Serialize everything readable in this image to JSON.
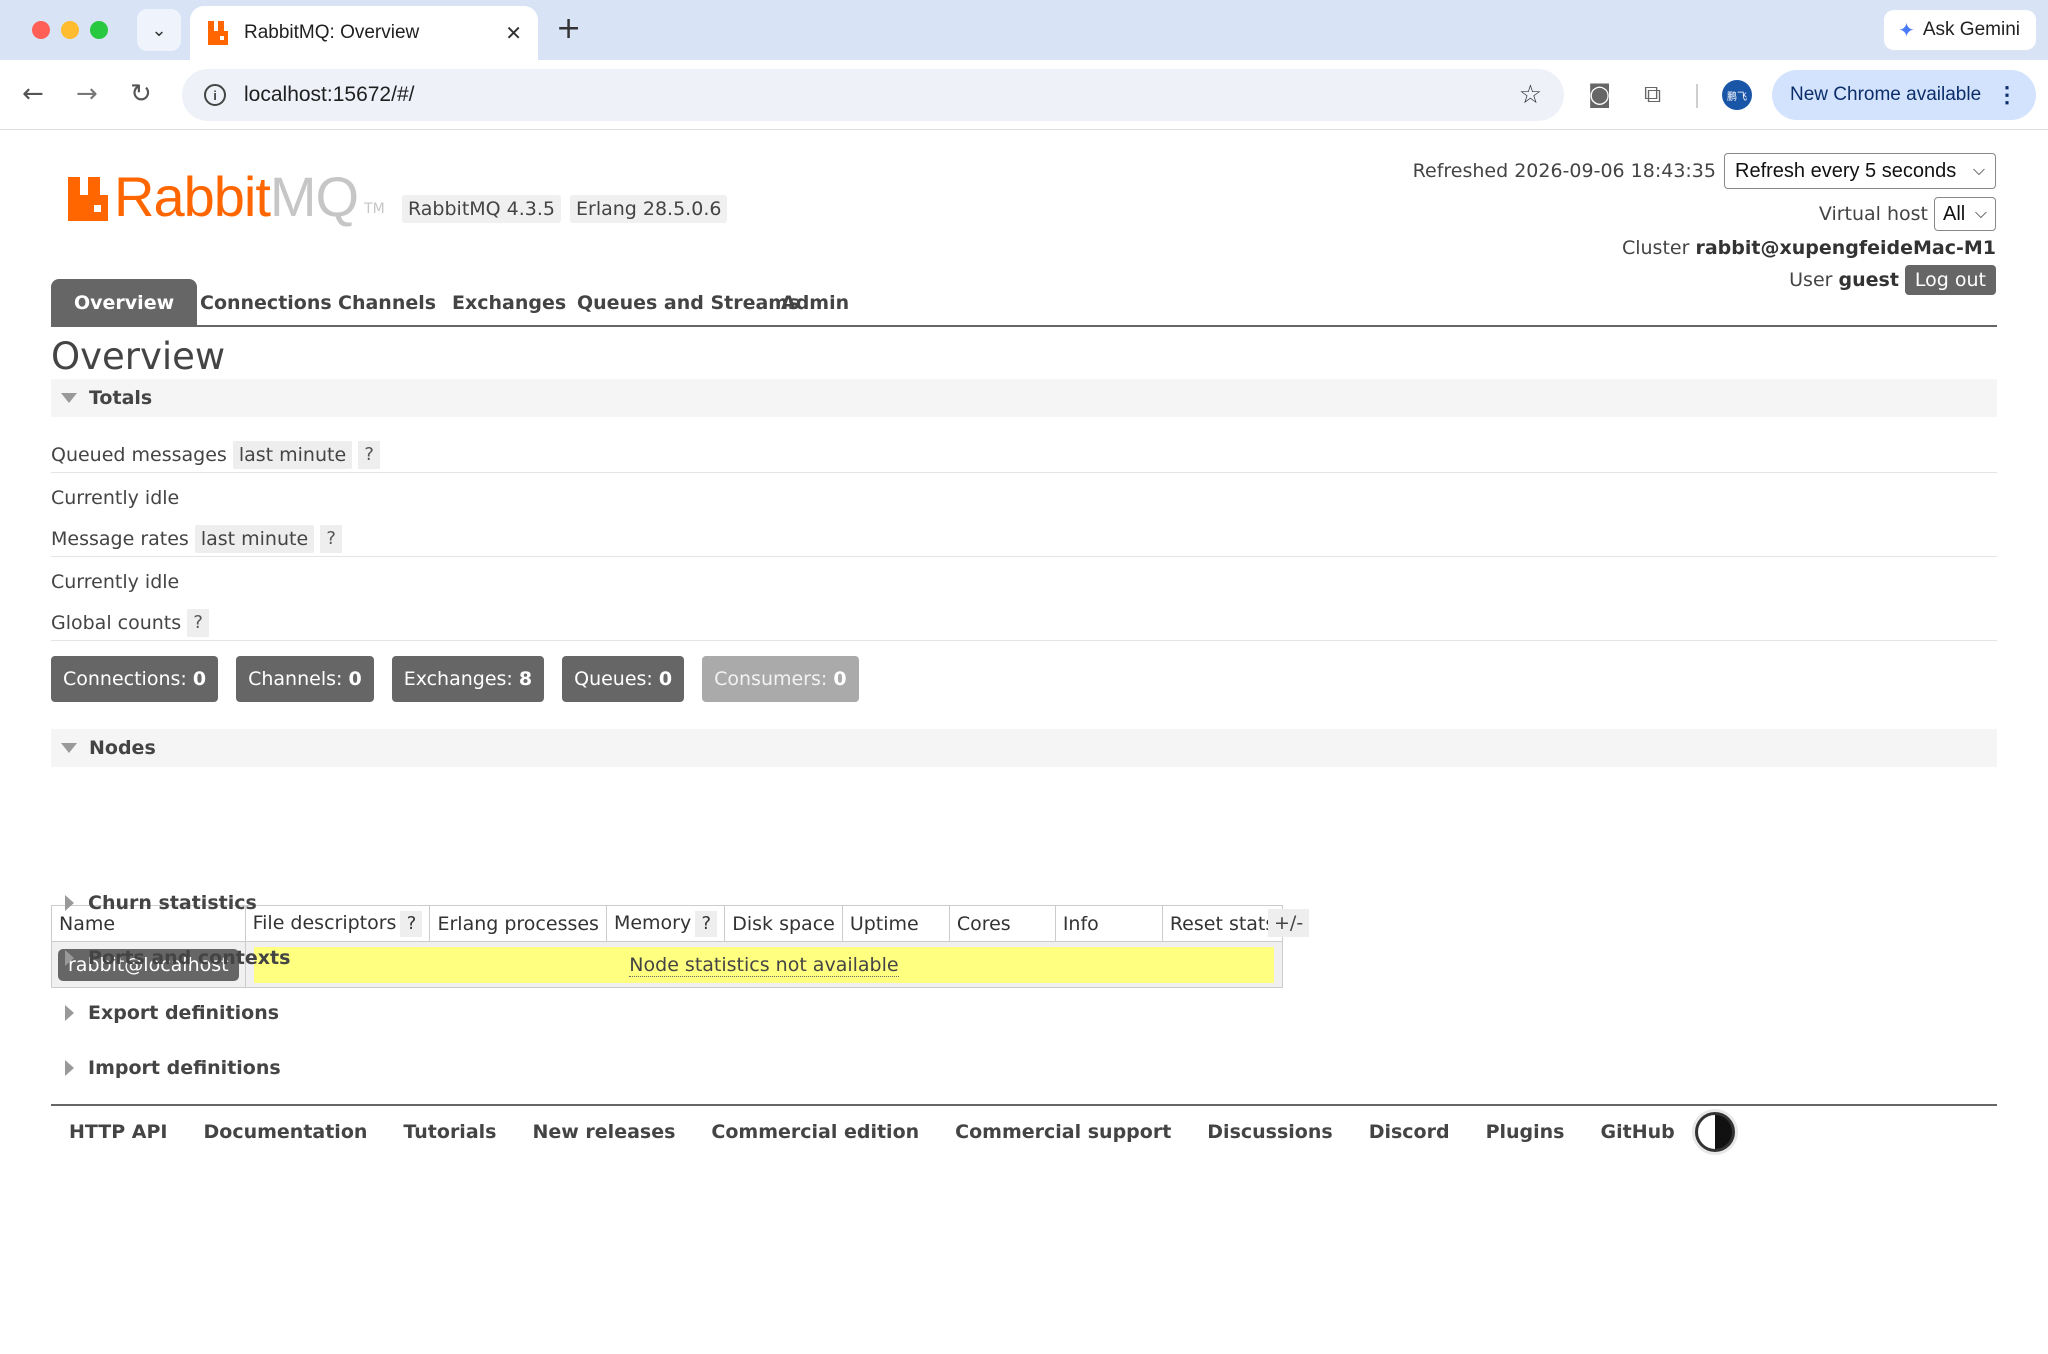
{
  "browser": {
    "tab_title": "RabbitMQ: Overview",
    "tab_close": "✕",
    "new_tab": "+",
    "ask_gemini": "Ask Gemini",
    "url": "localhost:15672/#/",
    "update_label": "New Chrome available",
    "profile_initials": "鹏飞",
    "icons": [
      "search-tabs-icon",
      "back-arrow-icon",
      "forward-arrow-icon",
      "reload-icon",
      "site-info-icon",
      "star-icon",
      "camera-icon",
      "extensions-icon",
      "kebab-menu-icon"
    ]
  },
  "header": {
    "logo_rabbit": "Rabbit",
    "logo_mq": "MQ",
    "logo_tm": "TM",
    "version_rabbitmq": "RabbitMQ 4.3.5",
    "version_erlang": "Erlang 28.5.0.6",
    "refreshed_label": "Refreshed 2026-09-06 18:43:35",
    "refresh_option": "Refresh every 5 seconds",
    "vhost_label": "Virtual host",
    "vhost_value": "All",
    "cluster_label": "Cluster",
    "cluster_value": "rabbit@xupengfeideMac-M1",
    "user_label": "User",
    "user_value": "guest",
    "logout_label": "Log out"
  },
  "tabs": [
    "Overview",
    "Connections",
    "Channels",
    "Exchanges",
    "Queues and Streams",
    "Admin"
  ],
  "page_title": "Overview",
  "totals": {
    "title": "Totals",
    "queued_messages": "Queued messages",
    "message_rates": "Message rates",
    "range": "last minute",
    "help": "?",
    "idle": "Currently idle",
    "global_counts": "Global counts"
  },
  "counts": [
    {
      "label": "Connections:",
      "value": "0"
    },
    {
      "label": "Channels:",
      "value": "0"
    },
    {
      "label": "Exchanges:",
      "value": "8"
    },
    {
      "label": "Queues:",
      "value": "0"
    },
    {
      "label": "Consumers:",
      "value": "0"
    }
  ],
  "nodes": {
    "title": "Nodes",
    "columns": [
      "Name",
      "File descriptors",
      "Erlang processes",
      "Memory",
      "Disk space",
      "Uptime",
      "Cores",
      "Info",
      "Reset stats"
    ],
    "help": "?",
    "toggle": "+/-",
    "rows": [
      {
        "name": "rabbit@localhost",
        "status": "Node statistics not available"
      }
    ]
  },
  "collapsed_sections": [
    "Churn statistics",
    "Ports and contexts",
    "Export definitions",
    "Import definitions"
  ],
  "footer_links": [
    "HTTP API",
    "Documentation",
    "Tutorials",
    "New releases",
    "Commercial edition",
    "Commercial support",
    "Discussions",
    "Discord",
    "Plugins",
    "GitHub"
  ],
  "colors": {
    "brand": "#ff6600",
    "tab_active": "#666666",
    "warning_bg": "#ffff80"
  }
}
